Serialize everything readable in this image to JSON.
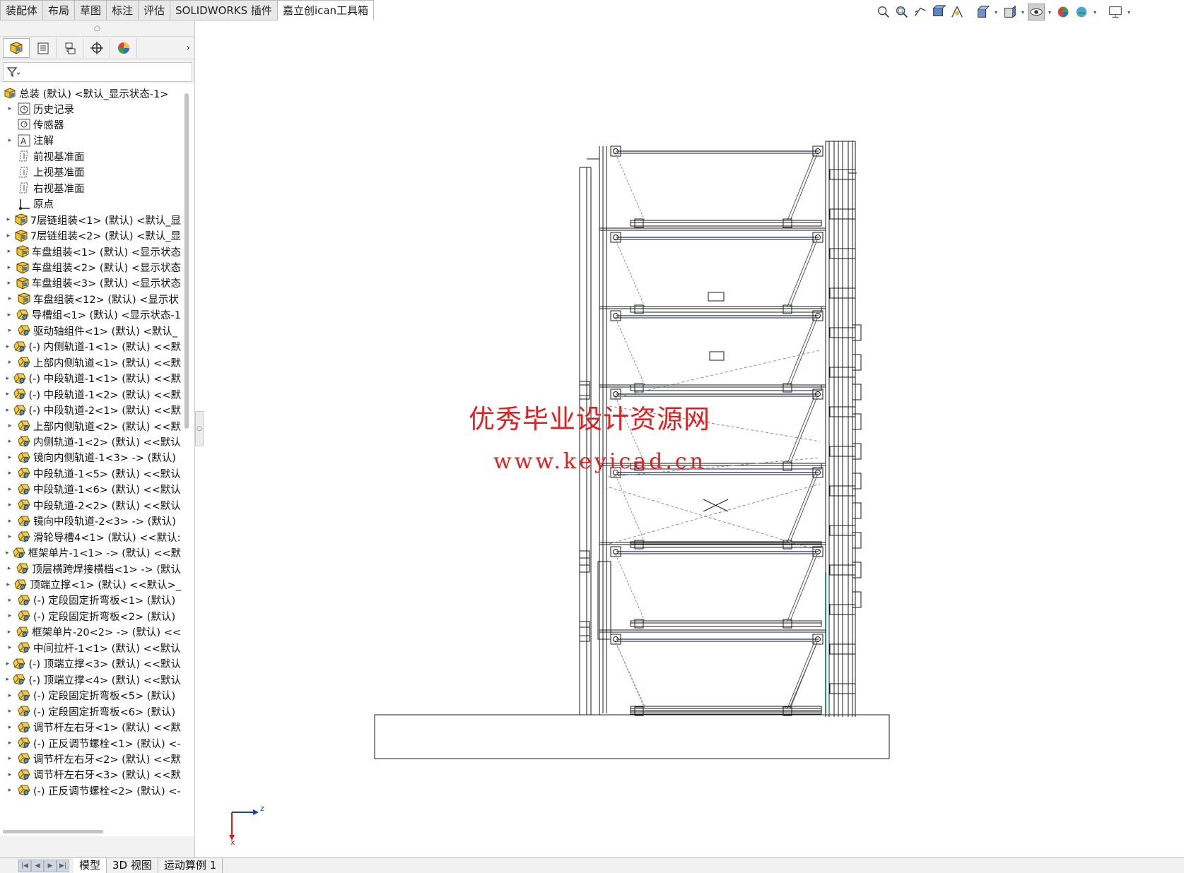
{
  "command_tabs": [
    "装配体",
    "布局",
    "草图",
    "标注",
    "评估",
    "SOLIDWORKS 插件",
    "嘉立创ican工具箱"
  ],
  "active_command_tab": "嘉立创ican工具箱",
  "heads_up_toolbar": [
    {
      "icon": "zoom-to-fit-icon"
    },
    {
      "icon": "zoom-to-area-icon"
    },
    {
      "icon": "previous-view-icon"
    },
    {
      "icon": "section-view-icon"
    },
    {
      "icon": "dynamic-annotation-icon"
    },
    {
      "icon": "view-orientation-icon",
      "dropdown": true
    },
    {
      "icon": "display-style-icon",
      "dropdown": true
    },
    {
      "icon": "hide-show-items-icon",
      "dropdown": true,
      "pressed": true
    },
    {
      "icon": "edit-appearance-icon"
    },
    {
      "icon": "apply-scene-icon",
      "dropdown": true
    },
    {
      "icon": "view-settings-icon",
      "dropdown": true
    }
  ],
  "panel_tabs": [
    {
      "icon": "featuremanager-tree-icon",
      "active": true
    },
    {
      "icon": "propertymanager-icon"
    },
    {
      "icon": "configurationmanager-icon"
    },
    {
      "icon": "dimxpertmanager-icon"
    },
    {
      "icon": "displaymanager-icon"
    }
  ],
  "filter": {
    "icon": "filter-icon"
  },
  "tree": {
    "root": "总装 (默认) <默认_显示状态-1>",
    "items": [
      {
        "label": "历史记录",
        "icon": "history-icon",
        "expander": true
      },
      {
        "label": "传感器",
        "icon": "sensor-icon",
        "expander": false
      },
      {
        "label": "注解",
        "icon": "annotations-icon",
        "expander": true
      },
      {
        "label": "前视基准面",
        "icon": "plane-icon",
        "expander": false
      },
      {
        "label": "上视基准面",
        "icon": "plane-icon",
        "expander": false
      },
      {
        "label": "右视基准面",
        "icon": "plane-icon",
        "expander": false
      },
      {
        "label": "原点",
        "icon": "origin-icon",
        "expander": false
      },
      {
        "label": "7层链组装<1> (默认) <默认_显",
        "icon": "subassembly-icon",
        "expander": true
      },
      {
        "label": "7层链组装<2> (默认) <默认_显",
        "icon": "subassembly-icon",
        "expander": true
      },
      {
        "label": "车盘组装<1> (默认) <显示状态",
        "icon": "subassembly-icon",
        "expander": true
      },
      {
        "label": "车盘组装<2> (默认) <显示状态",
        "icon": "subassembly-icon",
        "expander": true
      },
      {
        "label": "车盘组装<3> (默认) <显示状态",
        "icon": "subassembly-icon",
        "expander": true
      },
      {
        "label": "车盘组装<12> (默认) <显示状",
        "icon": "subassembly-icon",
        "expander": true
      },
      {
        "label": "导槽组<1> (默认) <显示状态-1",
        "icon": "part-icon",
        "expander": true
      },
      {
        "label": "驱动轴组件<1> (默认) <默认_",
        "icon": "part-icon",
        "expander": true
      },
      {
        "label": "(-) 内侧轨道-1<1> (默认) <<默",
        "icon": "part-icon",
        "expander": true
      },
      {
        "label": "上部内侧轨道<1> (默认) <<默",
        "icon": "part-icon",
        "expander": true
      },
      {
        "label": "(-) 中段轨道-1<1> (默认) <<默",
        "icon": "part-icon",
        "expander": true
      },
      {
        "label": "(-) 中段轨道-1<2> (默认) <<默",
        "icon": "part-icon",
        "expander": true
      },
      {
        "label": "(-) 中段轨道-2<1> (默认) <<默",
        "icon": "part-icon",
        "expander": true
      },
      {
        "label": "上部内侧轨道<2> (默认) <<默",
        "icon": "part-icon",
        "expander": true
      },
      {
        "label": "内侧轨道-1<2> (默认) <<默认",
        "icon": "part-icon",
        "expander": true
      },
      {
        "label": "镜向内侧轨道-1<3> -> (默认)",
        "icon": "part-icon",
        "expander": true
      },
      {
        "label": "中段轨道-1<5> (默认) <<默认",
        "icon": "part-icon",
        "expander": true
      },
      {
        "label": "中段轨道-1<6> (默认) <<默认",
        "icon": "part-icon",
        "expander": true
      },
      {
        "label": "中段轨道-2<2> (默认) <<默认",
        "icon": "part-icon",
        "expander": true
      },
      {
        "label": "镜向中段轨道-2<3> -> (默认)",
        "icon": "part-icon",
        "expander": true
      },
      {
        "label": "滑轮导槽4<1> (默认) <<默认:",
        "icon": "part-icon",
        "expander": true
      },
      {
        "label": "框架单片-1<1> -> (默认) <<默",
        "icon": "part-icon",
        "expander": true
      },
      {
        "label": "顶层横跨焊接横档<1> -> (默认",
        "icon": "part-icon",
        "expander": true
      },
      {
        "label": "顶端立撑<1> (默认) <<默认>_",
        "icon": "part-icon",
        "expander": true
      },
      {
        "label": "(-) 定段固定折弯板<1> (默认)",
        "icon": "part-icon",
        "expander": true
      },
      {
        "label": "(-) 定段固定折弯板<2> (默认)",
        "icon": "part-icon",
        "expander": true
      },
      {
        "label": "框架单片-20<2> -> (默认) <<",
        "icon": "part-icon",
        "expander": true
      },
      {
        "label": "中间拉杆-1<1> (默认) <<默认",
        "icon": "part-icon",
        "expander": true
      },
      {
        "label": "(-) 顶端立撑<3> (默认) <<默认",
        "icon": "part-icon",
        "expander": true
      },
      {
        "label": "(-) 顶端立撑<4> (默认) <<默认",
        "icon": "part-icon",
        "expander": true
      },
      {
        "label": "(-) 定段固定折弯板<5> (默认)",
        "icon": "part-icon",
        "expander": true
      },
      {
        "label": "(-) 定段固定折弯板<6> (默认)",
        "icon": "part-icon",
        "expander": true
      },
      {
        "label": "调节杆左右牙<1> (默认) <<默",
        "icon": "part-icon",
        "expander": true
      },
      {
        "label": "(-) 正反调节螺栓<1> (默认) <-",
        "icon": "part-icon",
        "expander": true
      },
      {
        "label": "调节杆左右牙<2> (默认) <<默",
        "icon": "part-icon",
        "expander": true
      },
      {
        "label": "调节杆左右牙<3> (默认) <<默",
        "icon": "part-icon",
        "expander": true
      },
      {
        "label": "(-) 正反调节螺栓<2> (默认) <-",
        "icon": "part-icon",
        "expander": true
      }
    ]
  },
  "bottom_tabs": [
    "模型",
    "3D 视图",
    "运动算例 1"
  ],
  "active_bottom_tab": "模型",
  "watermark": {
    "line1": "优秀毕业设计资源网",
    "line2": "www.keyicad.cn",
    "color": "#e31e1e"
  },
  "triad": {
    "z": "z",
    "x": "x"
  }
}
